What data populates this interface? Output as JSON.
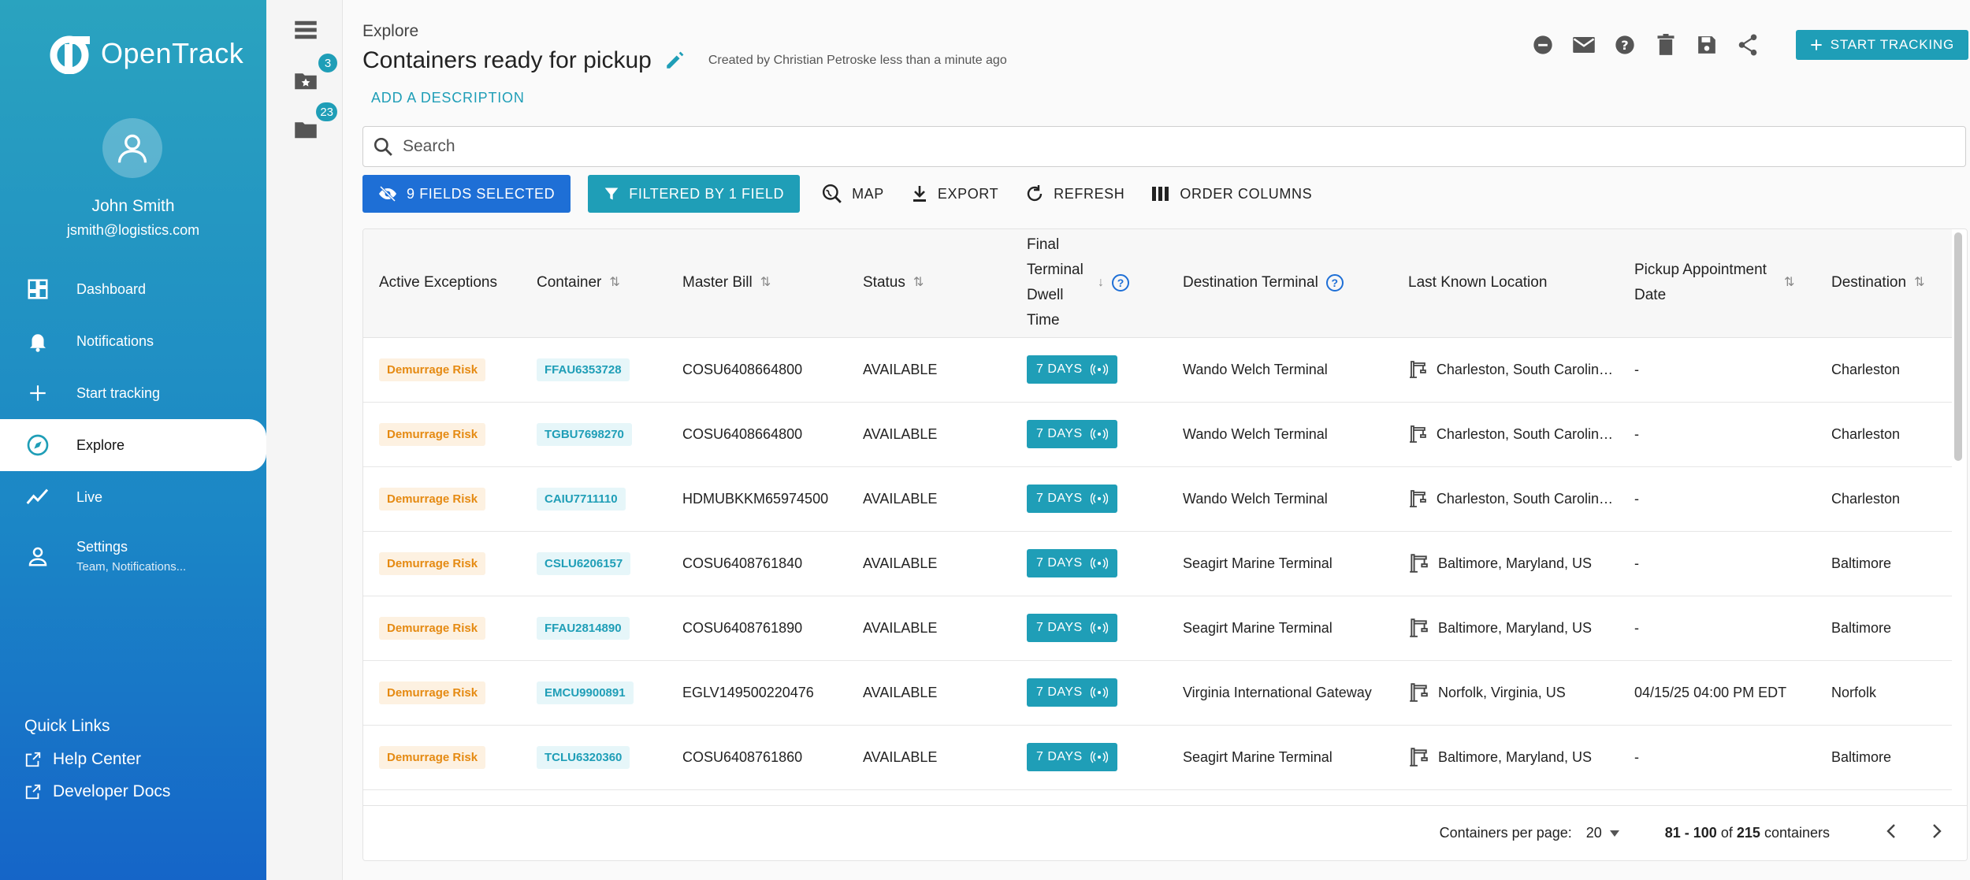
{
  "brand": {
    "name": "OpenTrack"
  },
  "user": {
    "name": "John Smith",
    "email": "jsmith@logistics.com"
  },
  "nav": [
    {
      "label": "Dashboard",
      "icon": "dashboard-icon"
    },
    {
      "label": "Notifications",
      "icon": "bell-icon"
    },
    {
      "label": "Start tracking",
      "icon": "plus-icon"
    },
    {
      "label": "Explore",
      "icon": "compass-icon",
      "active": true
    },
    {
      "label": "Live",
      "icon": "trend-icon"
    },
    {
      "label": "Settings",
      "sub": "Team, Notifications...",
      "icon": "person-icon"
    }
  ],
  "quick_links": {
    "title": "Quick Links",
    "items": [
      "Help Center",
      "Developer Docs"
    ]
  },
  "rail": {
    "starred_count": "3",
    "folder_count": "23"
  },
  "header": {
    "breadcrumb": "Explore",
    "title": "Containers ready for pickup",
    "created": "Created by Christian Petroske less than a minute ago",
    "add_description": "ADD A DESCRIPTION",
    "start_tracking": "START TRACKING"
  },
  "search": {
    "placeholder": "Search"
  },
  "toolbar": {
    "fields": "9 FIELDS SELECTED",
    "filter": "FILTERED BY 1 FIELD",
    "map": "MAP",
    "export": "EXPORT",
    "refresh": "REFRESH",
    "order": "ORDER COLUMNS"
  },
  "table": {
    "columns": [
      "Active Exceptions",
      "Container",
      "Master Bill",
      "Status",
      "Final Terminal Dwell Time",
      "Destination Terminal",
      "Last Known Location",
      "Pickup Appointment Date",
      "Destination"
    ],
    "rows": [
      [
        "Demurrage Risk",
        "FFAU6353728",
        "COSU6408664800",
        "AVAILABLE",
        "7 DAYS",
        "Wando Welch Terminal",
        "Charleston, South Carolina, US",
        "-",
        "Charleston"
      ],
      [
        "Demurrage Risk",
        "TGBU7698270",
        "COSU6408664800",
        "AVAILABLE",
        "7 DAYS",
        "Wando Welch Terminal",
        "Charleston, South Carolina, US",
        "-",
        "Charleston"
      ],
      [
        "Demurrage Risk",
        "CAIU7711110",
        "HDMUBKKM65974500",
        "AVAILABLE",
        "7 DAYS",
        "Wando Welch Terminal",
        "Charleston, South Carolina, US",
        "-",
        "Charleston"
      ],
      [
        "Demurrage Risk",
        "CSLU6206157",
        "COSU6408761840",
        "AVAILABLE",
        "7 DAYS",
        "Seagirt Marine Terminal",
        "Baltimore, Maryland, US",
        "-",
        "Baltimore"
      ],
      [
        "Demurrage Risk",
        "FFAU2814890",
        "COSU6408761890",
        "AVAILABLE",
        "7 DAYS",
        "Seagirt Marine Terminal",
        "Baltimore, Maryland, US",
        "-",
        "Baltimore"
      ],
      [
        "Demurrage Risk",
        "EMCU9900891",
        "EGLV149500220476",
        "AVAILABLE",
        "7 DAYS",
        "Virginia International Gateway",
        "Norfolk, Virginia, US",
        "04/15/25 04:00 PM EDT",
        "Norfolk"
      ],
      [
        "Demurrage Risk",
        "TCLU6320360",
        "COSU6408761860",
        "AVAILABLE",
        "7 DAYS",
        "Seagirt Marine Terminal",
        "Baltimore, Maryland, US",
        "-",
        "Baltimore"
      ]
    ]
  },
  "pagination": {
    "per_page_label": "Containers per page:",
    "per_page": "20",
    "range": "81 - 100",
    "of": "of",
    "total": "215",
    "unit": "containers"
  },
  "colors": {
    "teal": "#1f9eb7",
    "blue": "#1e6fd6",
    "risk": "#e58a12"
  }
}
